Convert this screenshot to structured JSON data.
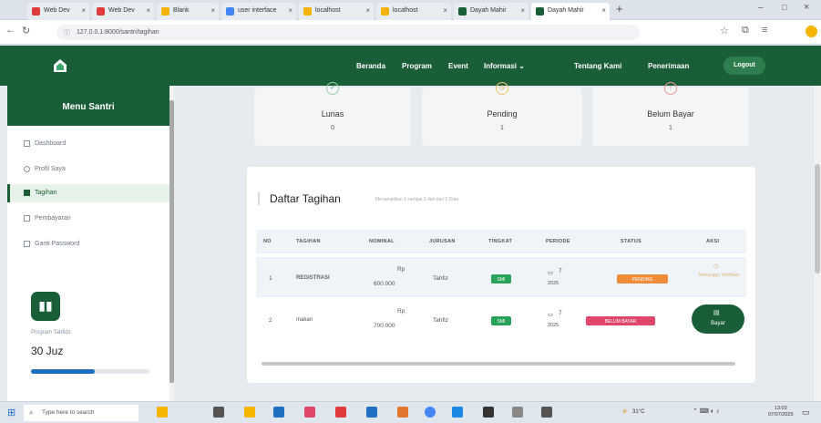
{
  "browser": {
    "tabs": [
      {
        "label": "Web Dev",
        "color": "#e03a3a"
      },
      {
        "label": "Web Dev",
        "color": "#e03a3a"
      },
      {
        "label": "Blank",
        "color": "#f4b400"
      },
      {
        "label": "user interface",
        "color": "#4285f4"
      },
      {
        "label": "localhost",
        "color": "#f4b400"
      },
      {
        "label": "localhost",
        "color": "#f4b400"
      },
      {
        "label": "Dayah Mahir",
        "color": "#1a5e38"
      },
      {
        "label": "Dayah Mahir",
        "color": "#1a5e38"
      }
    ],
    "url": "127.0.0.1:8000/santri/tagihan"
  },
  "nav": {
    "links": [
      "Beranda",
      "Program",
      "Event",
      "Informasi ⌄",
      "Tentang Kami",
      "Penerimaan"
    ],
    "logout": "Logout"
  },
  "sidebar": {
    "title": "Menu Santri",
    "items": [
      {
        "label": "Dashboard",
        "active": false
      },
      {
        "label": "Profil Saya",
        "active": false
      },
      {
        "label": "Tagihan",
        "active": true
      },
      {
        "label": "Pembayaran",
        "active": false
      },
      {
        "label": "Ganti Password",
        "active": false
      }
    ],
    "program_label": "Program Tahfidz",
    "program_value": "30 Juz",
    "program_progress": 0.54
  },
  "summary": [
    {
      "label": "Lunas",
      "value": "0",
      "icon": "check-icon"
    },
    {
      "label": "Pending",
      "value": "1",
      "icon": "clock-icon"
    },
    {
      "label": "Belum Bayar",
      "value": "1",
      "icon": "alert-icon"
    }
  ],
  "table": {
    "title": "Daftar Tagihan",
    "subtitle": "Menampilkan 1 sampai 2 dari dari 2 Data",
    "headers": [
      "NO",
      "TAGIHAN",
      "NOMINAL",
      "JURUSAN",
      "TINGKAT",
      "PERIODE",
      "STATUS",
      "AKSI"
    ],
    "rows": [
      {
        "no": "1",
        "tagihan": "REGISTRASI",
        "nominal_cur": "Rp",
        "nominal": "600.000",
        "jurusan": "Tahfiz",
        "tingkat": "SMI",
        "periode_m": "7",
        "periode_y": "2025",
        "status": "PENDING",
        "status_color": "#f08c3a",
        "aksi": "Menunggu Verifikasi"
      },
      {
        "no": "2",
        "tagihan": "makan",
        "nominal_cur": "Rp",
        "nominal": "700.000",
        "jurusan": "Tahfiz",
        "tingkat": "SMI",
        "periode_m": "7",
        "periode_y": "2025",
        "status": "BELUM BAYAR",
        "status_color": "#e0466a",
        "aksi": "Bayar"
      }
    ]
  },
  "taskbar": {
    "search": "Type here to search",
    "weather": "31°C",
    "time": "13:03",
    "date": "07/07/2025"
  }
}
